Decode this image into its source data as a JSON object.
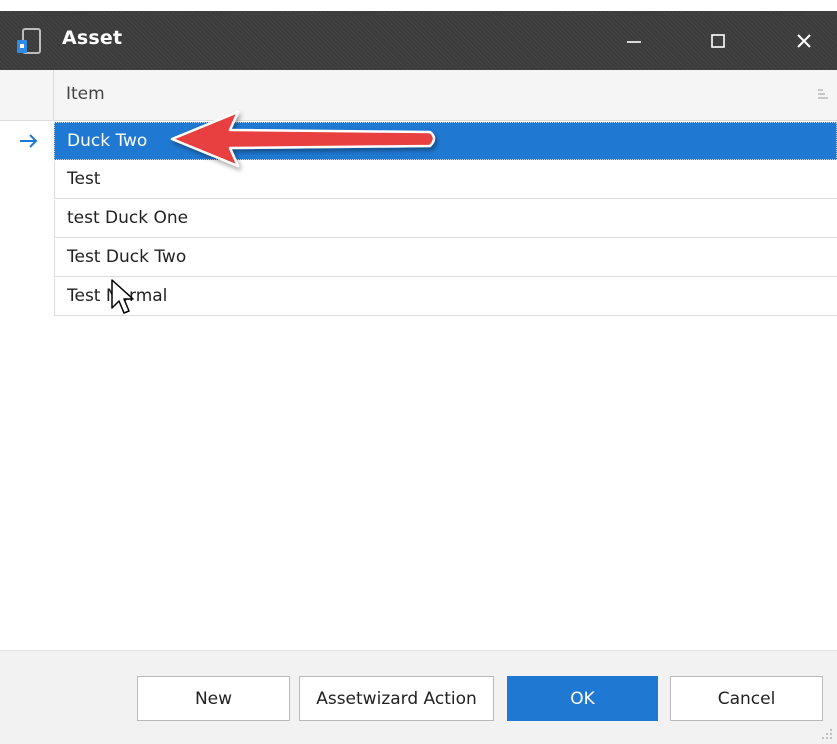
{
  "window": {
    "title": "Asset",
    "icon": "device-icon",
    "controls": [
      "minimize-icon",
      "maximize-icon",
      "close-icon"
    ]
  },
  "grid": {
    "column_header": "Item",
    "rows": [
      {
        "label": "Duck Two",
        "selected": true
      },
      {
        "label": "Test",
        "selected": false
      },
      {
        "label": "test Duck One",
        "selected": false
      },
      {
        "label": "Test Duck Two",
        "selected": false
      },
      {
        "label": "Test Normal",
        "selected": false
      }
    ]
  },
  "footer": {
    "new_label": "New",
    "wizard_label": "Assetwizard Action",
    "ok_label": "OK",
    "cancel_label": "Cancel"
  },
  "colors": {
    "titlebar": "#3c3c3c",
    "selection": "#1f78d1",
    "annotation": "#e8403f",
    "indicator": "#1f78d1"
  }
}
